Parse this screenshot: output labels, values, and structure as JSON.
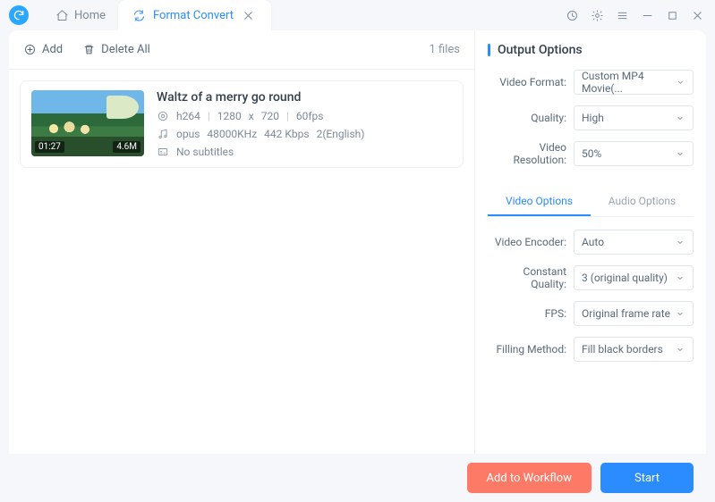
{
  "tabs": {
    "home": "Home",
    "active": "Format Convert"
  },
  "toolbar": {
    "add": "Add",
    "delete_all": "Delete All",
    "file_count": "1 files"
  },
  "file": {
    "title": "Waltz of a merry go round",
    "thumb_duration": "01:27",
    "thumb_size": "4.6M",
    "video_codec": "h264",
    "resolution_w": "1280",
    "x": "x",
    "resolution_h": "720",
    "fps": "60fps",
    "audio_codec": "opus",
    "audio_rate": "48000KHz",
    "audio_bitrate": "442 Kbps",
    "audio_ch": "2(English)",
    "subtitles": "No subtitles"
  },
  "output": {
    "title": "Output Options",
    "video_format_label": "Video Format:",
    "video_format_value": "Custom MP4 Movie(...",
    "quality_label": "Quality:",
    "quality_value": "High",
    "resolution_label": "Video Resolution:",
    "resolution_value": "50%"
  },
  "subtabs": {
    "video": "Video Options",
    "audio": "Audio Options"
  },
  "video_opts": {
    "encoder_label": "Video Encoder:",
    "encoder_value": "Auto",
    "cq_label": "Constant Quality:",
    "cq_value": "3 (original quality)",
    "fps_label": "FPS:",
    "fps_value": "Original frame rate",
    "fill_label": "Filling Method:",
    "fill_value": "Fill black borders"
  },
  "footer": {
    "workflow": "Add to Workflow",
    "start": "Start"
  }
}
